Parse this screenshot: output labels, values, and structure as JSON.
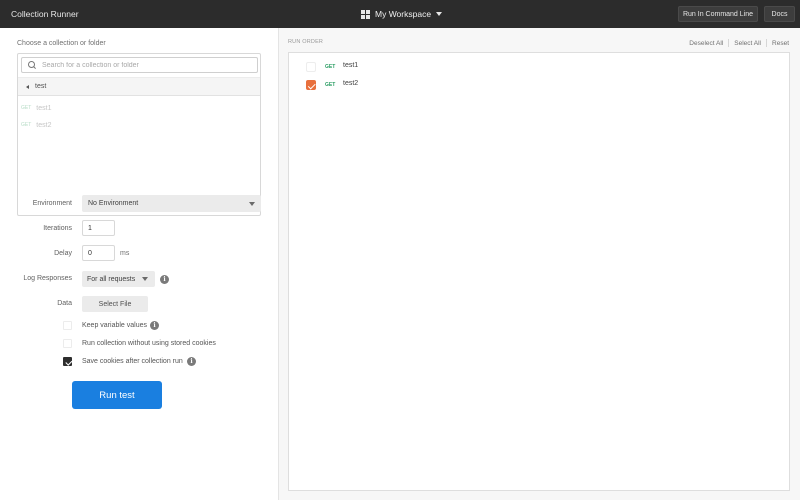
{
  "header": {
    "app_title": "Collection Runner",
    "workspace": "My Workspace",
    "run_cmdline_label": "Run In Command Line",
    "docs_label": "Docs"
  },
  "left": {
    "choose_label": "Choose a collection or folder",
    "search_placeholder": "Search for a collection or folder",
    "folder": "test",
    "requests": [
      {
        "method": "GET",
        "name": "test1"
      },
      {
        "method": "GET",
        "name": "test2"
      }
    ],
    "environment_label": "Environment",
    "environment_value": "No Environment",
    "iterations_label": "Iterations",
    "iterations_value": "1",
    "delay_label": "Delay",
    "delay_value": "0",
    "delay_unit": "ms",
    "log_label": "Log Responses",
    "log_value": "For all requests",
    "data_label": "Data",
    "select_file_label": "Select File",
    "options": [
      {
        "label": "Keep variable values",
        "checked": false
      },
      {
        "label": "Run collection without using stored cookies",
        "checked": false
      },
      {
        "label": "Save cookies after collection run",
        "checked": true
      }
    ],
    "run_label": "Run test"
  },
  "right": {
    "run_order_label": "RUN ORDER",
    "deselect_all": "Deselect All",
    "select_all": "Select All",
    "reset": "Reset",
    "items": [
      {
        "method": "GET",
        "name": "test1",
        "checked": false
      },
      {
        "method": "GET",
        "name": "test2",
        "checked": true
      }
    ]
  },
  "colors": {
    "header_bg": "#2c2c2c",
    "primary_button": "#1a7fe0",
    "checked_orange": "#e8703d",
    "method_get": "#2a9d63"
  }
}
